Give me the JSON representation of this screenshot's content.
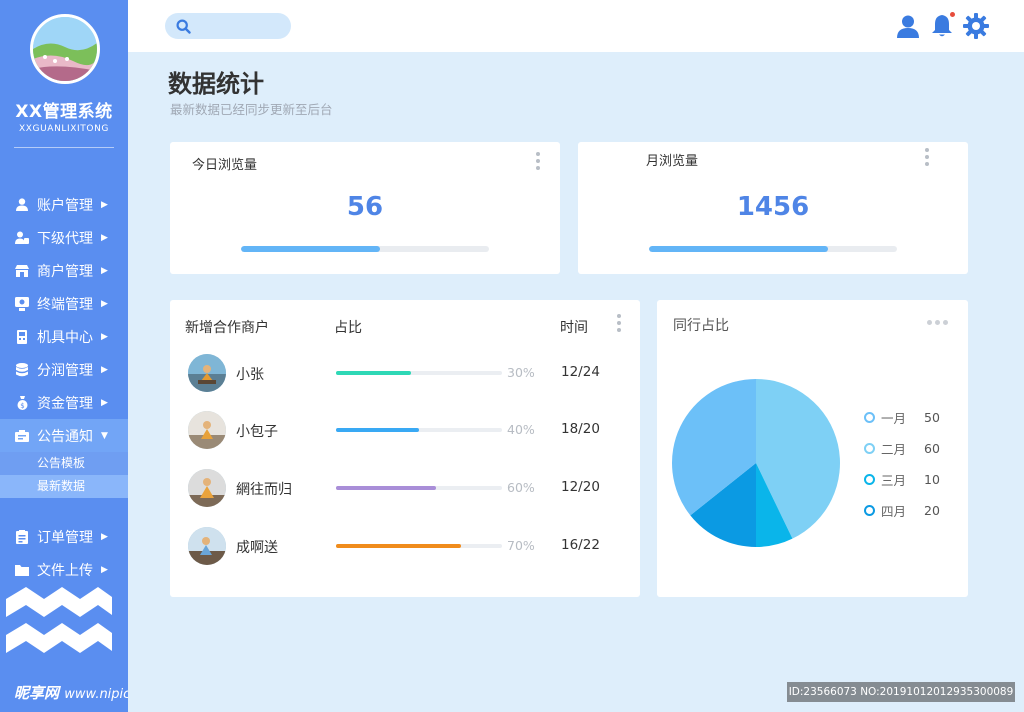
{
  "brand": {
    "title": "XX管理系统",
    "subtitle": "XXGUANLIXITONG"
  },
  "menu": {
    "items": [
      {
        "label": "账户管理",
        "icon": "user-icon"
      },
      {
        "label": "下级代理",
        "icon": "agent-icon"
      },
      {
        "label": "商户管理",
        "icon": "store-icon"
      },
      {
        "label": "终端管理",
        "icon": "terminal-icon"
      },
      {
        "label": "机具中心",
        "icon": "device-icon"
      },
      {
        "label": "分润管理",
        "icon": "database-icon"
      },
      {
        "label": "资金管理",
        "icon": "money-bag-icon"
      },
      {
        "label": "公告通知",
        "icon": "notice-icon"
      },
      {
        "label": "订单管理",
        "icon": "order-icon"
      },
      {
        "label": "文件上传",
        "icon": "folder-icon"
      }
    ],
    "sub_items": [
      {
        "label": "公告模板"
      },
      {
        "label": "最新数据"
      }
    ]
  },
  "search": {
    "placeholder": "",
    "value": ""
  },
  "page": {
    "title": "数据统计",
    "subtitle": "最新数据已经同步更新至后台"
  },
  "stats": {
    "today": {
      "label": "今日浏览量",
      "value": "56",
      "progress": 0.56
    },
    "month": {
      "label": "月浏览量",
      "value": "1456",
      "progress": 0.72
    }
  },
  "merchants": {
    "headers": {
      "name": "新增合作商户",
      "ratio": "占比",
      "time": "时间"
    },
    "rows": [
      {
        "name": "小张",
        "pct": "30%",
        "progress": 0.45,
        "time": "12/24",
        "color": "#2ed8b6"
      },
      {
        "name": "小包子",
        "pct": "40%",
        "progress": 0.5,
        "time": "18/20",
        "color": "#39a9f4"
      },
      {
        "name": "網往而归",
        "pct": "60%",
        "progress": 0.6,
        "time": "12/20",
        "color": "#a98ed8"
      },
      {
        "name": "成啊送",
        "pct": "70%",
        "progress": 0.75,
        "time": "16/22",
        "color": "#f08c1c"
      }
    ]
  },
  "chart_data": {
    "type": "pie",
    "title": "同行占比",
    "categories": [
      "一月",
      "二月",
      "三月",
      "四月"
    ],
    "values": [
      50,
      60,
      10,
      20
    ],
    "colors": [
      "#6cc0f8",
      "#7ed0f5",
      "#0ab5ea",
      "#0b9ae3"
    ],
    "legend": "right"
  },
  "watermarks": {
    "left": "昵享网",
    "left_url": "www.nipic.cn",
    "right": "ID:23566073 NO:20191012012935300089"
  }
}
